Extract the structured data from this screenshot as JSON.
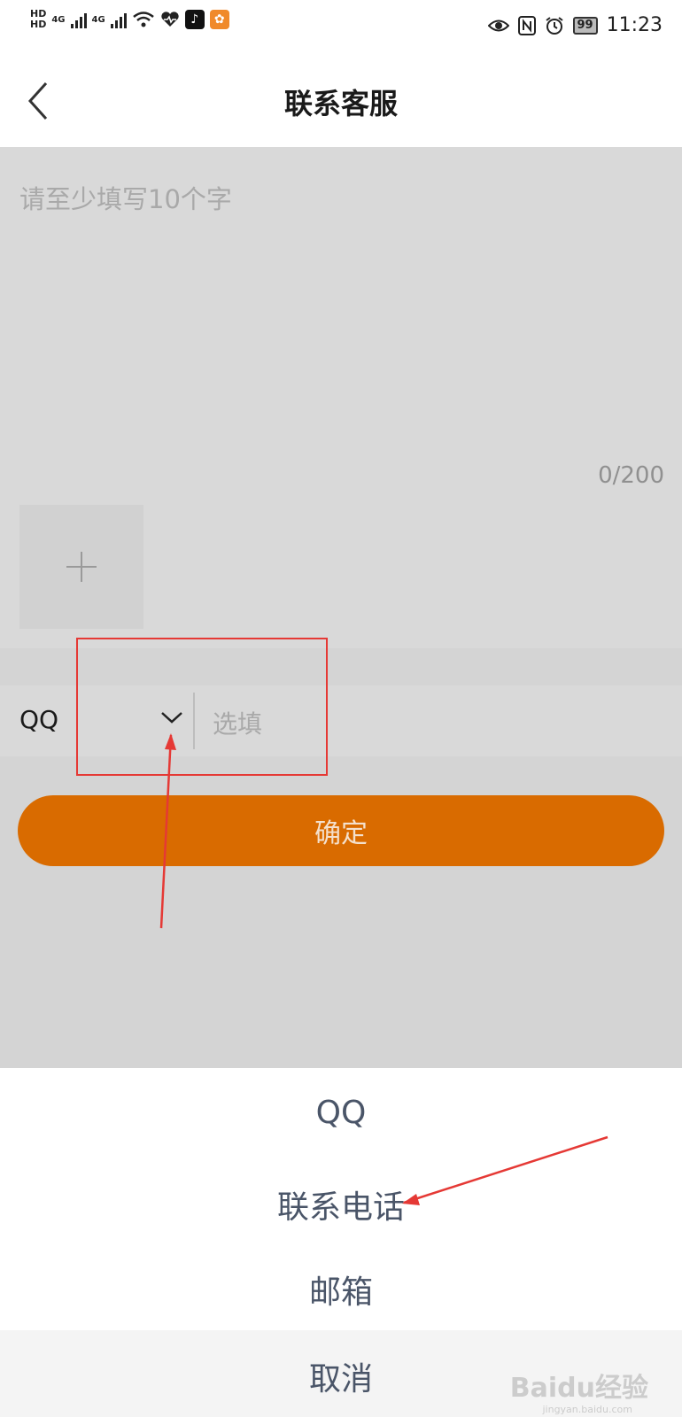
{
  "status_bar": {
    "time": "11:23",
    "battery": "99",
    "network_1": "4G",
    "network_2": "4G",
    "hd_1": "HD",
    "hd_2": "HD",
    "icons": [
      "signal-icon",
      "wifi-icon",
      "heart-icon",
      "tiktok-icon",
      "uc-browser-icon",
      "eye-icon",
      "nfc-icon",
      "alarm-icon",
      "battery-icon"
    ]
  },
  "header": {
    "title": "联系客服"
  },
  "feedback": {
    "placeholder": "请至少填写10个字",
    "counter": "0/200"
  },
  "contact": {
    "type_selected": "QQ",
    "input_placeholder": "选填"
  },
  "confirm_label": "确定",
  "action_sheet": {
    "options": [
      "QQ",
      "联系电话",
      "邮箱"
    ],
    "cancel_label": "取消"
  },
  "watermark": {
    "text": "Baidu经验",
    "url": "jingyan.baidu.com"
  },
  "colors": {
    "accent": "#d96b00",
    "overlay": "#d4d4d4",
    "annotation": "#e53935"
  }
}
